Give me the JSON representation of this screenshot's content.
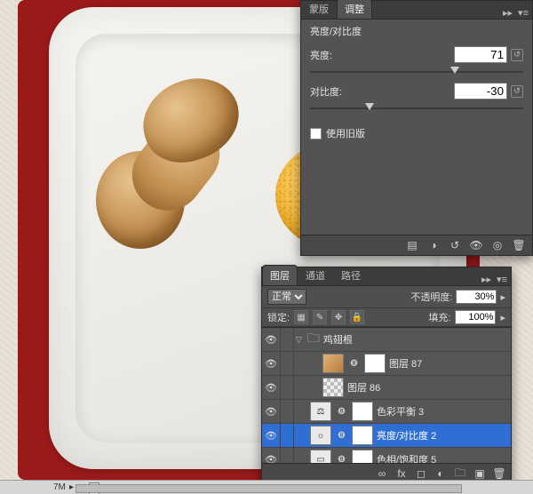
{
  "adjustments": {
    "tabs": [
      "蒙版",
      "调整"
    ],
    "title": "亮度/对比度",
    "brightness": {
      "label": "亮度:",
      "value": "71"
    },
    "contrast": {
      "label": "对比度:",
      "value": "-30"
    },
    "use_legacy": "使用旧版"
  },
  "layers": {
    "tabs": [
      "图层",
      "通道",
      "路径"
    ],
    "blend_mode": "正常",
    "opacity_label": "不透明度:",
    "opacity_value": "30%",
    "lock_label": "锁定:",
    "fill_label": "填充:",
    "fill_value": "100%",
    "items": [
      {
        "name": "鸡翅根"
      },
      {
        "name": "图层 87"
      },
      {
        "name": "图层 86"
      },
      {
        "name": "色彩平衡 3"
      },
      {
        "name": "亮度/对比度 2"
      },
      {
        "name": "色相/饱和度 5"
      }
    ]
  },
  "status": {
    "size": "7M"
  }
}
